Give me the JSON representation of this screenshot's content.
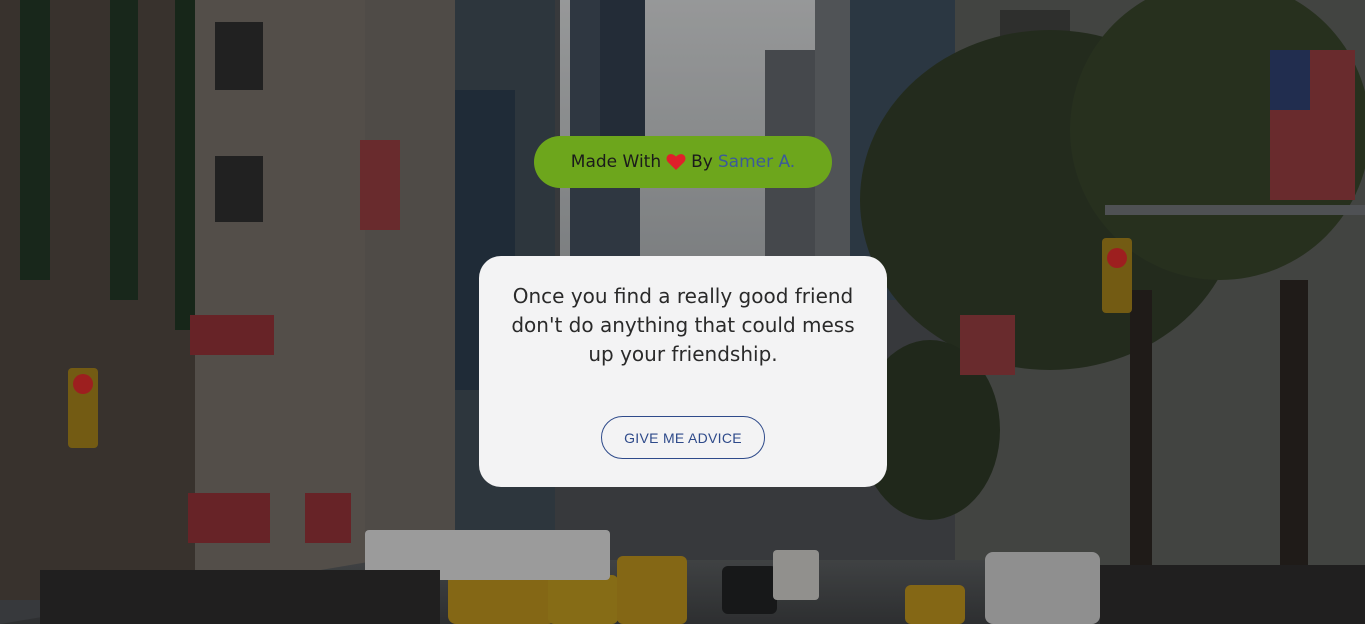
{
  "badge": {
    "prefix": "Made With",
    "heart_icon": "heart-icon",
    "by": "By",
    "author": "Samer A.",
    "bg_color": "#6da61c",
    "author_color": "#3b5a9a"
  },
  "card": {
    "quote": "Once you find a really good friend don't do anything that could mess up your friendship.",
    "button_label": "GIVE ME ADVICE"
  }
}
